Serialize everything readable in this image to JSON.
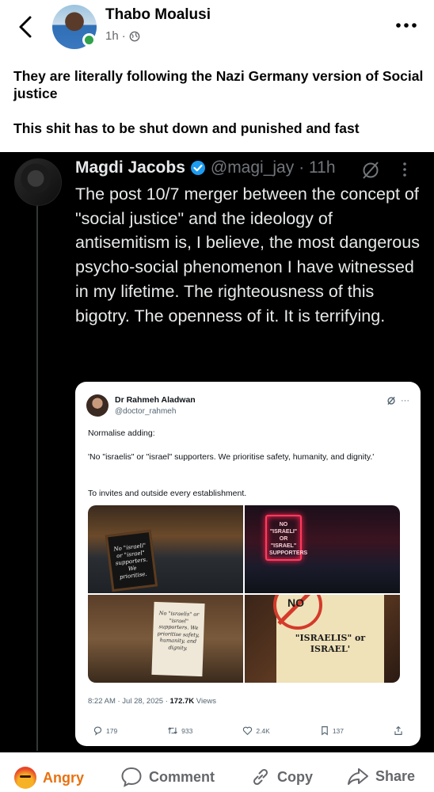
{
  "post": {
    "author": "Thabo Moalusi",
    "time": "1h",
    "separator": "·",
    "text_lines": [
      "They are literally following the Nazi Germany version of Social justice",
      "This shit has to be shut down and punished and fast"
    ]
  },
  "tweet": {
    "name": "Magdi Jacobs",
    "handle": "@magi_jay",
    "time": "· 11h",
    "body": "The post 10/7 merger between the concept of \"social justice\" and the ideology of antisemitism is, I believe, the most dangerous psycho-social phenomenon I have witnessed in my lifetime. The righteousness of this bigotry. The openness of it. It is terrifying."
  },
  "quoted": {
    "name": "Dr Rahmeh Aladwan",
    "handle": "@doctor_rahmeh",
    "more": "···",
    "para1": "Normalise adding:",
    "para2": "'No \"israelis\" or \"israel\" supporters. We prioritise safety, humanity, and dignity.'",
    "para3": "To invites and outside every establishment.",
    "images": {
      "img1_sign": "No \"israeli\" or \"israel\" supporters. We prioritise.",
      "img2_sign": "NO \"ISRAELI\" OR \"ISRAEL\" SUPPORTERS",
      "img3_sign": "No \"israelis\" or \"israel\" supporters. We prioritise safety, humanity, and dignity.",
      "img4_no": "NO",
      "img4_sign": "\"ISRAELIS\" or ISRAEL'"
    },
    "timestamp": "8:22 AM · Jul 28, 2025 ·",
    "views_count": "172.7K",
    "views_label": "Views",
    "replies": "179",
    "reposts": "933",
    "likes": "2.4K",
    "bookmarks": "137"
  },
  "actions": {
    "angry": "Angry",
    "comment": "Comment",
    "copy": "Copy",
    "share": "Share"
  },
  "colors": {
    "angry_accent": "#e9710f",
    "online_dot": "#31a24c",
    "verified_badge": "#1d9bf0"
  },
  "icons": [
    "back-chevron-icon",
    "globe-icon",
    "more-horizontal-icon",
    "verified-badge-icon",
    "grok-icon",
    "kebab-icon",
    "reply-icon",
    "repost-icon",
    "like-icon",
    "bookmark-icon",
    "share-icon",
    "comment-icon",
    "copy-icon",
    "share-arrow-icon"
  ]
}
